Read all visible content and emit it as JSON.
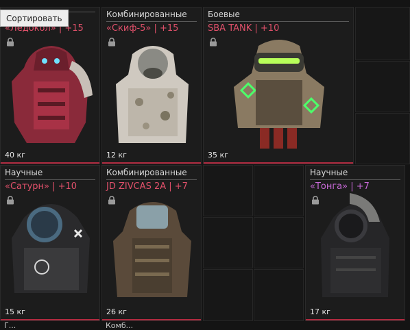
{
  "tooltip": {
    "sort_label": "Сортировать"
  },
  "items": [
    {
      "category": "",
      "name": "«Ледокол» | +15",
      "weight": "40 кг",
      "name_color": "#e0506a",
      "art_icon": "red-armor-icon"
    },
    {
      "category": "Комбинированные",
      "name": "«Скиф-5» | +15",
      "weight": "12 кг",
      "name_color": "#e0506a",
      "art_icon": "camo-armor-icon"
    },
    {
      "category": "Боевые",
      "name": "SBA TANK | +10",
      "weight": "35 кг",
      "name_color": "#e0506a",
      "art_icon": "tank-armor-icon"
    },
    {
      "category": "Научные",
      "name": "«Сатурн» | +10",
      "weight": "15 кг",
      "name_color": "#e0506a",
      "art_icon": "saturn-armor-icon"
    },
    {
      "category": "Комбинированные",
      "name": "JD ZIVCAS 2A | +7",
      "weight": "26 кг",
      "name_color": "#e0506a",
      "art_icon": "zivcas-armor-icon"
    },
    {
      "category": "Научные",
      "name": "«Тонга» | +7",
      "weight": "17 кг",
      "name_color": "#c86ad8",
      "art_icon": "tonga-armor-icon"
    }
  ],
  "next_row": {
    "partial_label_1": "Г...",
    "partial_label_2": "Комб..."
  },
  "colors": {
    "rarity_bar": "#b02a40",
    "name_red": "#e0506a",
    "name_purple": "#c86ad8"
  }
}
